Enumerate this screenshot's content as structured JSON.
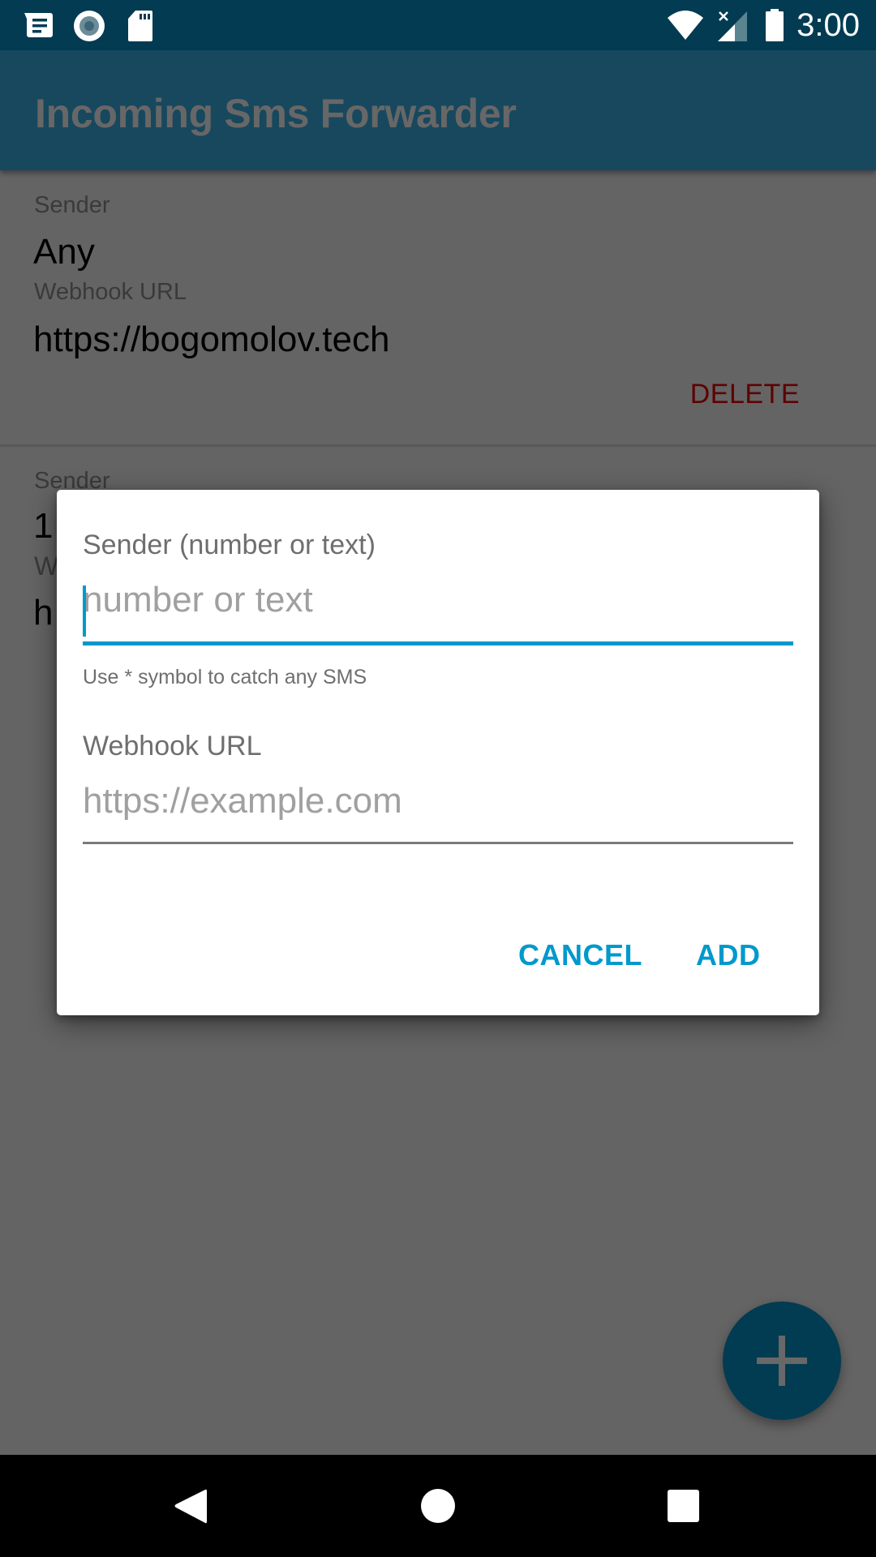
{
  "status_bar": {
    "time": "3:00",
    "left_icons": [
      "messages-notification-icon",
      "record-notification-icon",
      "sd-card-icon"
    ],
    "right_icons": [
      "wifi-icon",
      "cell-signal-no-data-icon",
      "battery-icon"
    ]
  },
  "app_bar": {
    "title": "Incoming Sms Forwarder"
  },
  "list": {
    "items": [
      {
        "sender_label": "Sender",
        "sender_value": "Any",
        "url_label": "Webhook URL",
        "url_value": "https://bogomolov.tech",
        "delete_label": "DELETE"
      },
      {
        "sender_label": "Sender",
        "sender_value": "1",
        "url_label": "W",
        "url_value": "h"
      }
    ]
  },
  "dialog": {
    "sender_label": "Sender (number or text)",
    "sender_value": "",
    "sender_placeholder": "number or text",
    "sender_helper": "Use * symbol to catch any SMS",
    "url_label": "Webhook URL",
    "url_value": "",
    "url_placeholder": "https://example.com",
    "cancel_label": "CANCEL",
    "add_label": "ADD"
  },
  "fab": {
    "icon": "plus-icon"
  },
  "nav_bar": {
    "buttons": [
      "back",
      "home",
      "recents"
    ]
  },
  "colors": {
    "accent": "#0099cc",
    "primary_dark": "#023b52",
    "delete": "#5e0202"
  }
}
